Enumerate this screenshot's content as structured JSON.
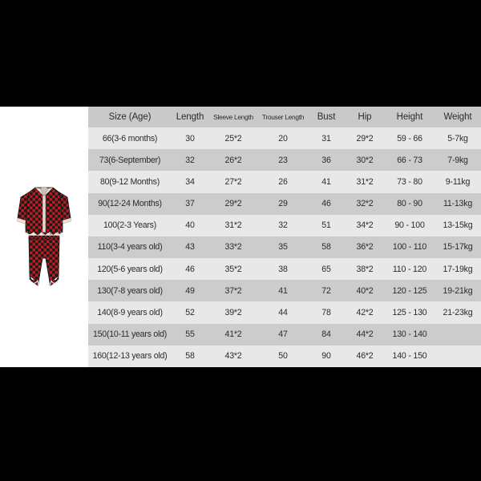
{
  "document": {
    "type": "size-chart",
    "background_color": "#000000",
    "panel_color": "#ffffff",
    "header_row_color": "#c9c9c9",
    "row_color_light": "#e8e8e8",
    "row_color_dark": "#cccccc",
    "text_color": "#2b2b2b"
  },
  "product_image": {
    "name": "plaid-pajama-set",
    "description": "Red and black buffalo plaid two-piece pajama set",
    "colors": {
      "plaid_red": "#b51d22",
      "plaid_black": "#1a1a1a",
      "trim": "#e9e2d8"
    }
  },
  "table": {
    "headers": [
      "Size (Age)",
      "Length",
      "Sleeve Length",
      "Trouser Length",
      "Bust",
      "Hip",
      "Height",
      "Weight"
    ],
    "rows": [
      {
        "size": "66(3-6 months)",
        "length": "30",
        "sleeve": "25*2",
        "trouser": "20",
        "bust": "31",
        "hip": "29*2",
        "height": "59 - 66",
        "weight": "5-7kg"
      },
      {
        "size": "73(6-September)",
        "length": "32",
        "sleeve": "26*2",
        "trouser": "23",
        "bust": "36",
        "hip": "30*2",
        "height": "66 - 73",
        "weight": "7-9kg"
      },
      {
        "size": "80(9-12 Months)",
        "length": "34",
        "sleeve": "27*2",
        "trouser": "26",
        "bust": "41",
        "hip": "31*2",
        "height": "73 - 80",
        "weight": "9-11kg"
      },
      {
        "size": "90(12-24 Months)",
        "length": "37",
        "sleeve": "29*2",
        "trouser": "29",
        "bust": "46",
        "hip": "32*2",
        "height": "80 - 90",
        "weight": "11-13kg"
      },
      {
        "size": "100(2-3 Years)",
        "length": "40",
        "sleeve": "31*2",
        "trouser": "32",
        "bust": "51",
        "hip": "34*2",
        "height": "90 - 100",
        "weight": "13-15kg"
      },
      {
        "size": "110(3-4 years old)",
        "length": "43",
        "sleeve": "33*2",
        "trouser": "35",
        "bust": "58",
        "hip": "36*2",
        "height": "100 - 110",
        "weight": "15-17kg"
      },
      {
        "size": "120(5-6 years old)",
        "length": "46",
        "sleeve": "35*2",
        "trouser": "38",
        "bust": "65",
        "hip": "38*2",
        "height": "110 - 120",
        "weight": "17-19kg"
      },
      {
        "size": "130(7-8 years old)",
        "length": "49",
        "sleeve": "37*2",
        "trouser": "41",
        "bust": "72",
        "hip": "40*2",
        "height": "120 - 125",
        "weight": "19-21kg"
      },
      {
        "size": "140(8-9 years old)",
        "length": "52",
        "sleeve": "39*2",
        "trouser": "44",
        "bust": "78",
        "hip": "42*2",
        "height": "125 - 130",
        "weight": "21-23kg"
      },
      {
        "size": "150(10-11 years old)",
        "length": "55",
        "sleeve": "41*2",
        "trouser": "47",
        "bust": "84",
        "hip": "44*2",
        "height": "130 - 140",
        "weight": ""
      },
      {
        "size": "160(12-13 years old)",
        "length": "58",
        "sleeve": "43*2",
        "trouser": "50",
        "bust": "90",
        "hip": "46*2",
        "height": "140 - 150",
        "weight": ""
      }
    ]
  }
}
